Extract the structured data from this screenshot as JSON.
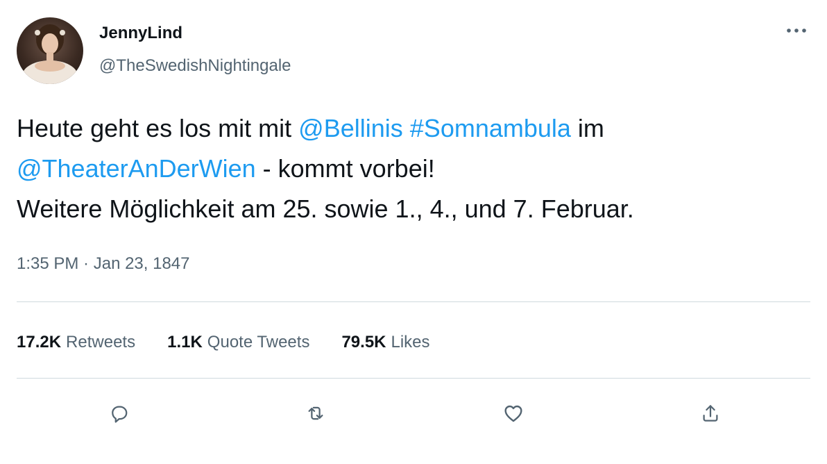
{
  "author": {
    "name": "JennyLind",
    "handle": "@TheSwedishNightingale",
    "avatar": "portrait-avatar"
  },
  "tweet": {
    "line1": {
      "t1": "Heute geht es los mit mit ",
      "mention1": "@Bellinis",
      "t2": " ",
      "hashtag": "#Somnambula",
      "t3": " im"
    },
    "line2": {
      "mention2": "@TheaterAnDerWien",
      "t4": " - kommt vorbei!"
    },
    "line3": "Weitere Möglichkeit am 25. sowie 1., 4., und 7. Februar."
  },
  "timestamp": {
    "time": "1:35 PM",
    "separator": " · ",
    "date": "Jan 23, 1847"
  },
  "stats": {
    "retweets": {
      "count": "17.2K",
      "label": "Retweets"
    },
    "quotes": {
      "count": "1.1K",
      "label": "Quote Tweets"
    },
    "likes": {
      "count": "79.5K",
      "label": "Likes"
    }
  },
  "icons": {
    "more": "more-horizontal-icon",
    "reply": "reply-icon",
    "retweet": "retweet-icon",
    "like": "heart-icon",
    "share": "share-icon"
  },
  "colors": {
    "link": "#1d9bf0",
    "text": "#0f1419",
    "secondary": "#536471",
    "divider": "#cfd9de"
  }
}
